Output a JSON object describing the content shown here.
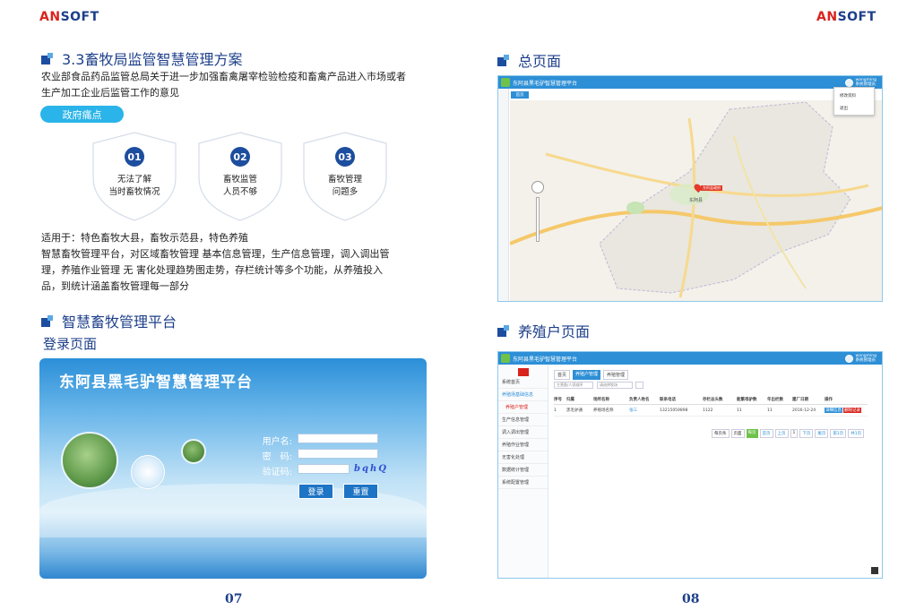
{
  "brand": {
    "logo_a": "AN",
    "logo_b": "SOFT"
  },
  "left_page": {
    "section_title": "3.3畜牧局监管智慧管理方案",
    "intro_line1": "农业部食品药品监管总局关于进一步加强畜禽屠宰检验检疫和畜禽产品进入市场或者",
    "intro_line2": "生产加工企业后监管工作的意见",
    "pain_label": "政府痛点",
    "pain_points": [
      {
        "num": "01",
        "line1": "无法了解",
        "line2": "当时畜牧情况"
      },
      {
        "num": "02",
        "line1": "畜牧监管",
        "line2": "人员不够"
      },
      {
        "num": "03",
        "line1": "畜牧管理",
        "line2": "问题多"
      }
    ],
    "applies_line": "适用于：特色畜牧大县，畜牧示范县，特色养殖",
    "desc_line1": "智慧畜牧管理平台，对区域畜牧管理   基本信息管理，生产信息管理，调入调出管",
    "desc_line2": "理，养殖作业管理   无   害化处理趋势图走势，存栏统计等多个功能，从养殖投入",
    "desc_line3": "品，到统计涵盖畜牧管理每一部分",
    "platform_title": "智慧畜牧管理平台",
    "login_heading": "登录页面",
    "login": {
      "system_title": "东阿县黑毛驴智慧管理平台",
      "username_label": "用户名:",
      "password_label": "密　码:",
      "captcha_label": "验证码:",
      "captcha_text": "bqhQ",
      "login_button": "登录",
      "reset_button": "重置"
    },
    "page_number": "07"
  },
  "right_page": {
    "overview_title": "总页面",
    "farm_title": "养殖户页面",
    "app_title": "东阿县黑毛驴智慧管理平台",
    "user_name": "wangming",
    "user_role": "系统管理员",
    "menu_profile": "修改资料",
    "menu_logout": "退出",
    "map_tab": "首页",
    "map_center_label": "东阿县",
    "map_marker": "东阿县政府",
    "farm_tabs": [
      "首页",
      "养殖户管理",
      "养殖管理"
    ],
    "search_placeholder": "主营畜/人家顺序",
    "select_placeholder": "请选择牧场",
    "table_headers": [
      "序号",
      "归属",
      "场所名称",
      "负责人姓名",
      "联系电话",
      "存栏总头数",
      "能繁母驴数",
      "年出栏数",
      "建厂日期",
      "操作"
    ],
    "table_row": [
      "1",
      "黑毛驴通",
      "养殖场名称",
      "张三",
      "13215059898",
      "1122",
      "11",
      "11",
      "2016-12-24"
    ],
    "row_actions": [
      "详细信息",
      "删除记录"
    ],
    "sidebar": [
      "系统首页",
      "养殖场基础信息",
      "养殖户管理",
      "生产信息管理",
      "调入调出管理",
      "养殖作业管理",
      "无害化处理",
      "数据统计管理",
      "系统配置管理"
    ],
    "pager": [
      "每页条",
      "页面",
      "每页",
      "首页",
      "上页",
      "1",
      "下页",
      "尾页",
      "第1页",
      "共1页"
    ],
    "page_number": "08"
  },
  "colors": {
    "brand_red": "#d9231d",
    "brand_blue": "#1d3f8a",
    "accent_cyan": "#2ab4e9",
    "app_blue": "#2d8fd6"
  }
}
